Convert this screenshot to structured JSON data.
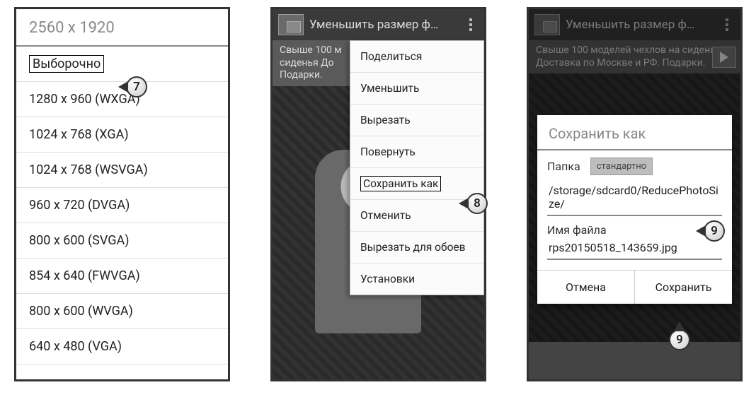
{
  "phone1": {
    "title": "2560 x 1920",
    "items": [
      "Выборочно",
      "1280 x 960 (WXGA)",
      "1024 x 768 (XGA)",
      "1024 x 768 (WSVGA)",
      "960 x 720 (DVGA)",
      "800 x 600 (SVGA)",
      "854 x 640 (FWVGA)",
      "800 x 600 (WVGA)",
      "640 x 480 (VGA)"
    ]
  },
  "phone2": {
    "app_title": "Уменьшить размер ф…",
    "ad_text": "Свыше 100 м\nсиденья До\nПодарки.",
    "menu": [
      "Поделиться",
      "Уменьшить",
      "Вырезать",
      "Повернуть",
      "Сохранить как",
      "Отменить",
      "Вырезать для обоев",
      "Установки"
    ]
  },
  "phone3": {
    "app_title": "Уменьшить размер ф…",
    "ad_text": "Свыше 100 моделей чехлов на сиденья Доставка по Москве и РФ. Подарки.",
    "dialog": {
      "title": "Сохранить как",
      "folder_label": "Папка",
      "std_button": "стандартно",
      "path": "/storage/sdcard0/ReducePhotoSize/",
      "filename_label": "Имя файла",
      "filename": "rps20150518_143659.jpg",
      "cancel": "Отмена",
      "save": "Сохранить"
    }
  },
  "callouts": {
    "c7": "7",
    "c8": "8",
    "c9a": "9",
    "c9b": "9"
  }
}
